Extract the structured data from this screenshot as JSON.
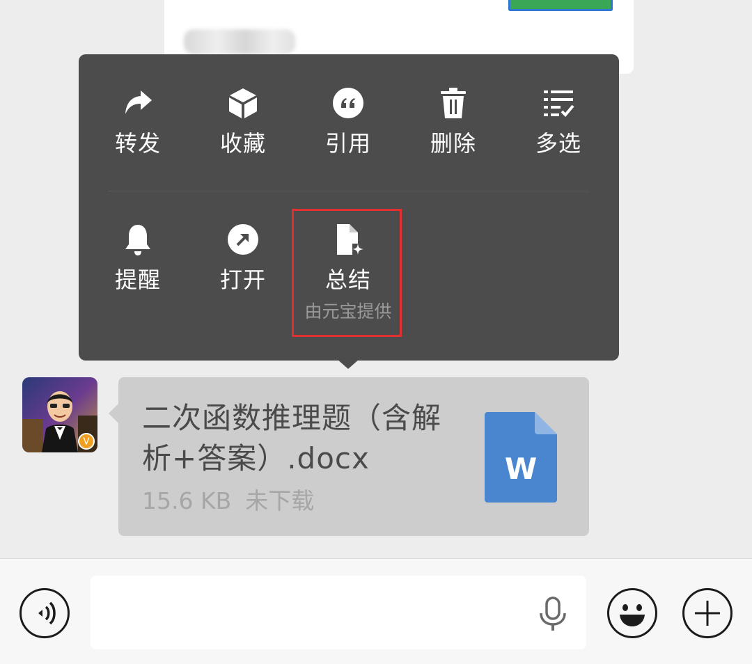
{
  "menu": {
    "row1": [
      {
        "label": "转发",
        "icon": "forward-icon"
      },
      {
        "label": "收藏",
        "icon": "favorite-box-icon"
      },
      {
        "label": "引用",
        "icon": "quote-icon"
      },
      {
        "label": "删除",
        "icon": "trash-icon"
      },
      {
        "label": "多选",
        "icon": "multi-select-icon"
      }
    ],
    "row2": [
      {
        "label": "提醒",
        "icon": "bell-icon"
      },
      {
        "label": "打开",
        "icon": "open-arrow-icon"
      },
      {
        "label": "总结",
        "icon": "ai-summary-doc-icon",
        "sublabel": "由元宝提供"
      }
    ]
  },
  "message": {
    "file_name": "二次函数推理题（含解析+答案）.docx",
    "file_size": "15.6 KB",
    "status": "未下载",
    "file_icon_letter": "W",
    "file_icon_color": "#4a86cf",
    "avatar_badge": "V"
  },
  "input_bar": {
    "placeholder": ""
  },
  "colors": {
    "menu_bg": "#4c4c4c",
    "highlight_border": "#e03030",
    "bubble_bg": "#cdcdcd"
  }
}
